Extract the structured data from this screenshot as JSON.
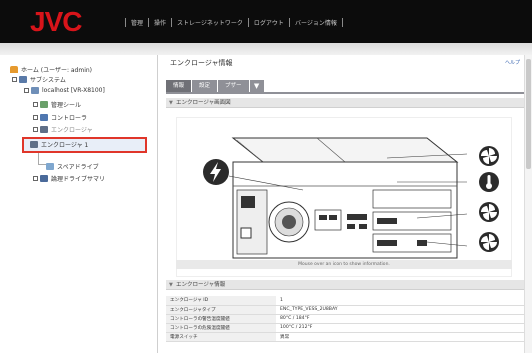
{
  "brand": "JVC",
  "topnav": [
    "管理",
    "操作",
    "ストレージネットワーク",
    "ログアウト",
    "バージョン情報"
  ],
  "tree": {
    "home": "ホーム (ユーザー: admin)",
    "system": "サブシステム",
    "host": "localhost [VR-X8100]",
    "fan": "管理シール",
    "controller": "コントローラ",
    "enclosure_parent": "エンクロージャ",
    "selected": "エンクロージャ 1",
    "spare": "スペアドライブ",
    "logical": "論理ドライブサマリ"
  },
  "main": {
    "title": "エンクロージャ情報",
    "help": "ヘルプ",
    "tabs": [
      "情報",
      "設定",
      "ブザー",
      "▼"
    ],
    "diagram_section": "エンクロージャ画面図",
    "diagram_note": "Mouse over an icon to show information.",
    "info_section": "エンクロージャ情報",
    "rows": [
      {
        "key": "エンクロージャ ID",
        "value": "1"
      },
      {
        "key": "エンクロージャタイプ",
        "value": "ENC_TYPE_VESS_2U8BAY"
      },
      {
        "key": "コントローラの警告温度閾値",
        "value": "80°C / 184°F"
      },
      {
        "key": "コントローラの危険温度閾値",
        "value": "100°C / 212°F"
      },
      {
        "key": "電源スイッチ",
        "value": "異常"
      }
    ]
  },
  "colors": {
    "accent": "#d8141a",
    "highlight": "#e0362a",
    "tab": "#8f9097"
  }
}
